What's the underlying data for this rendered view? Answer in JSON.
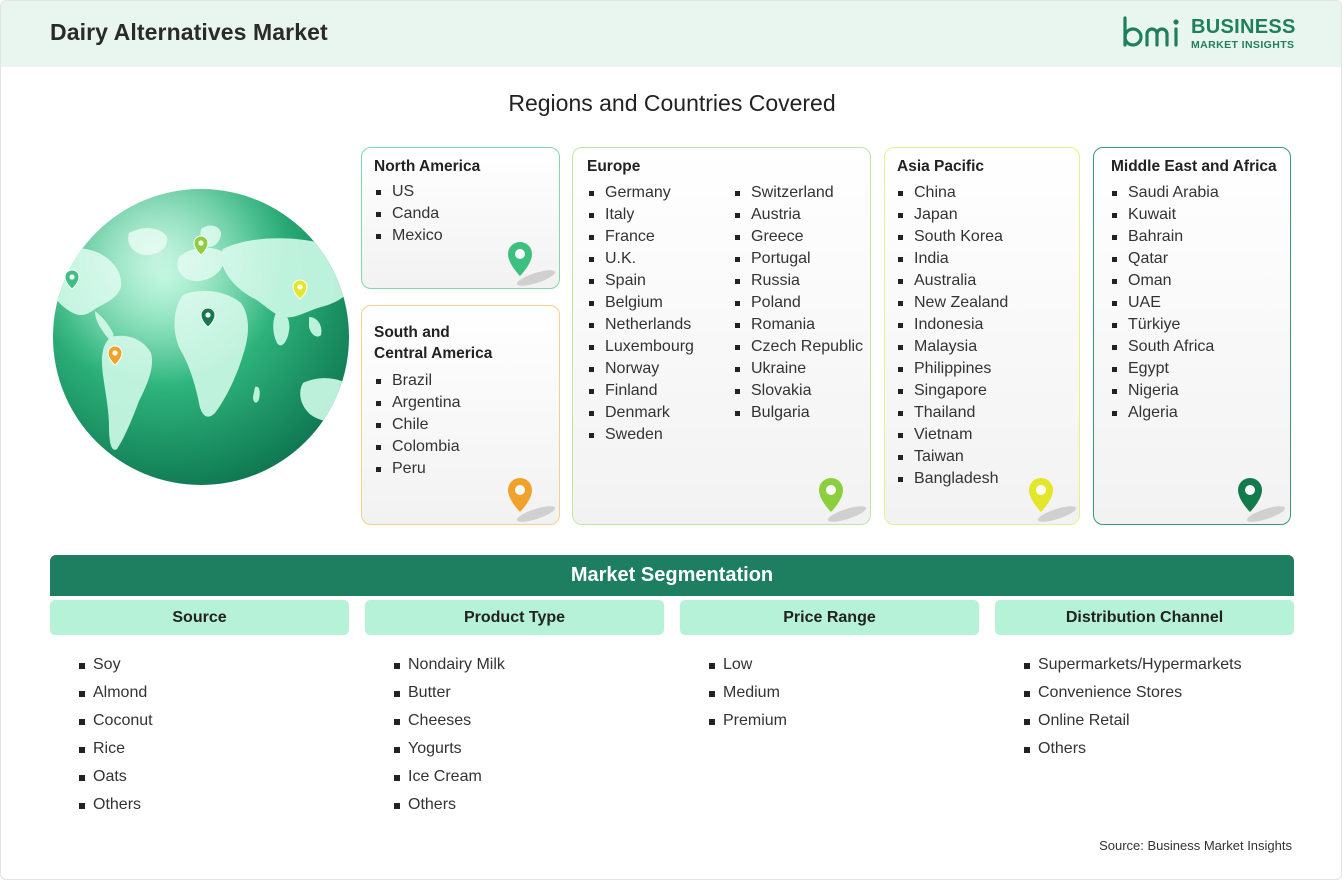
{
  "header": {
    "title": "Dairy Alternatives Market",
    "logo_main": "BUSINESS",
    "logo_sub": "MARKET INSIGHTS"
  },
  "regions_title": "Regions and Countries Covered",
  "regions": {
    "north_america": {
      "title": "North America",
      "items": [
        "US",
        "Canda",
        "Mexico"
      ],
      "color": "#3cc07f"
    },
    "south_central_america": {
      "title_line1": "South and",
      "title_line2": "Central America",
      "items": [
        "Brazil",
        "Argentina",
        "Chile",
        "Colombia",
        "Peru"
      ],
      "color": "#f0a22a"
    },
    "europe": {
      "title": "Europe",
      "col1": [
        "Germany",
        "Italy",
        "France",
        "U.K.",
        "Spain",
        "Belgium",
        "Netherlands",
        "Luxembourg",
        "Norway",
        "Finland",
        "Denmark",
        "Sweden"
      ],
      "col2": [
        "Switzerland",
        "Austria",
        "Greece",
        "Portugal",
        "Russia",
        "Poland",
        "Romania",
        "Czech Republic",
        "Ukraine",
        "Slovakia",
        "Bulgaria"
      ],
      "color": "#8ccf3e"
    },
    "asia_pacific": {
      "title": "Asia Pacific",
      "items": [
        "China",
        "Japan",
        "South Korea",
        "India",
        "Australia",
        "New Zealand",
        "Indonesia",
        "Malaysia",
        "Philippines",
        "Singapore",
        "Thailand",
        "Vietnam",
        "Taiwan",
        "Bangladesh"
      ],
      "color": "#e4e62a"
    },
    "middle_east_africa": {
      "title": "Middle East and Africa",
      "items": [
        "Saudi Arabia",
        "Kuwait",
        "Bahrain",
        "Qatar",
        "Oman",
        "UAE",
        "Türkiye",
        "South Africa",
        "Egypt",
        "Nigeria",
        "Algeria"
      ],
      "color": "#137a4c"
    }
  },
  "segmentation": {
    "title": "Market Segmentation",
    "columns": [
      {
        "header": "Source",
        "items": [
          "Soy",
          "Almond",
          "Coconut",
          "Rice",
          "Oats",
          "Others"
        ]
      },
      {
        "header": "Product Type",
        "items": [
          "Nondairy Milk",
          "Butter",
          "Cheeses",
          "Yogurts",
          "Ice Cream",
          "Others"
        ]
      },
      {
        "header": "Price Range",
        "items": [
          "Low",
          "Medium",
          "Premium"
        ]
      },
      {
        "header": "Distribution Channel",
        "items": [
          "Supermarkets/Hypermarkets",
          "Convenience Stores",
          "Online Retail",
          "Others"
        ]
      }
    ]
  },
  "source_note": "Source: Business Market Insights",
  "colors": {
    "brand_green": "#1d7f5f",
    "header_bg": "#e9f6ef",
    "segment_header_bg": "#b6f2d7"
  }
}
